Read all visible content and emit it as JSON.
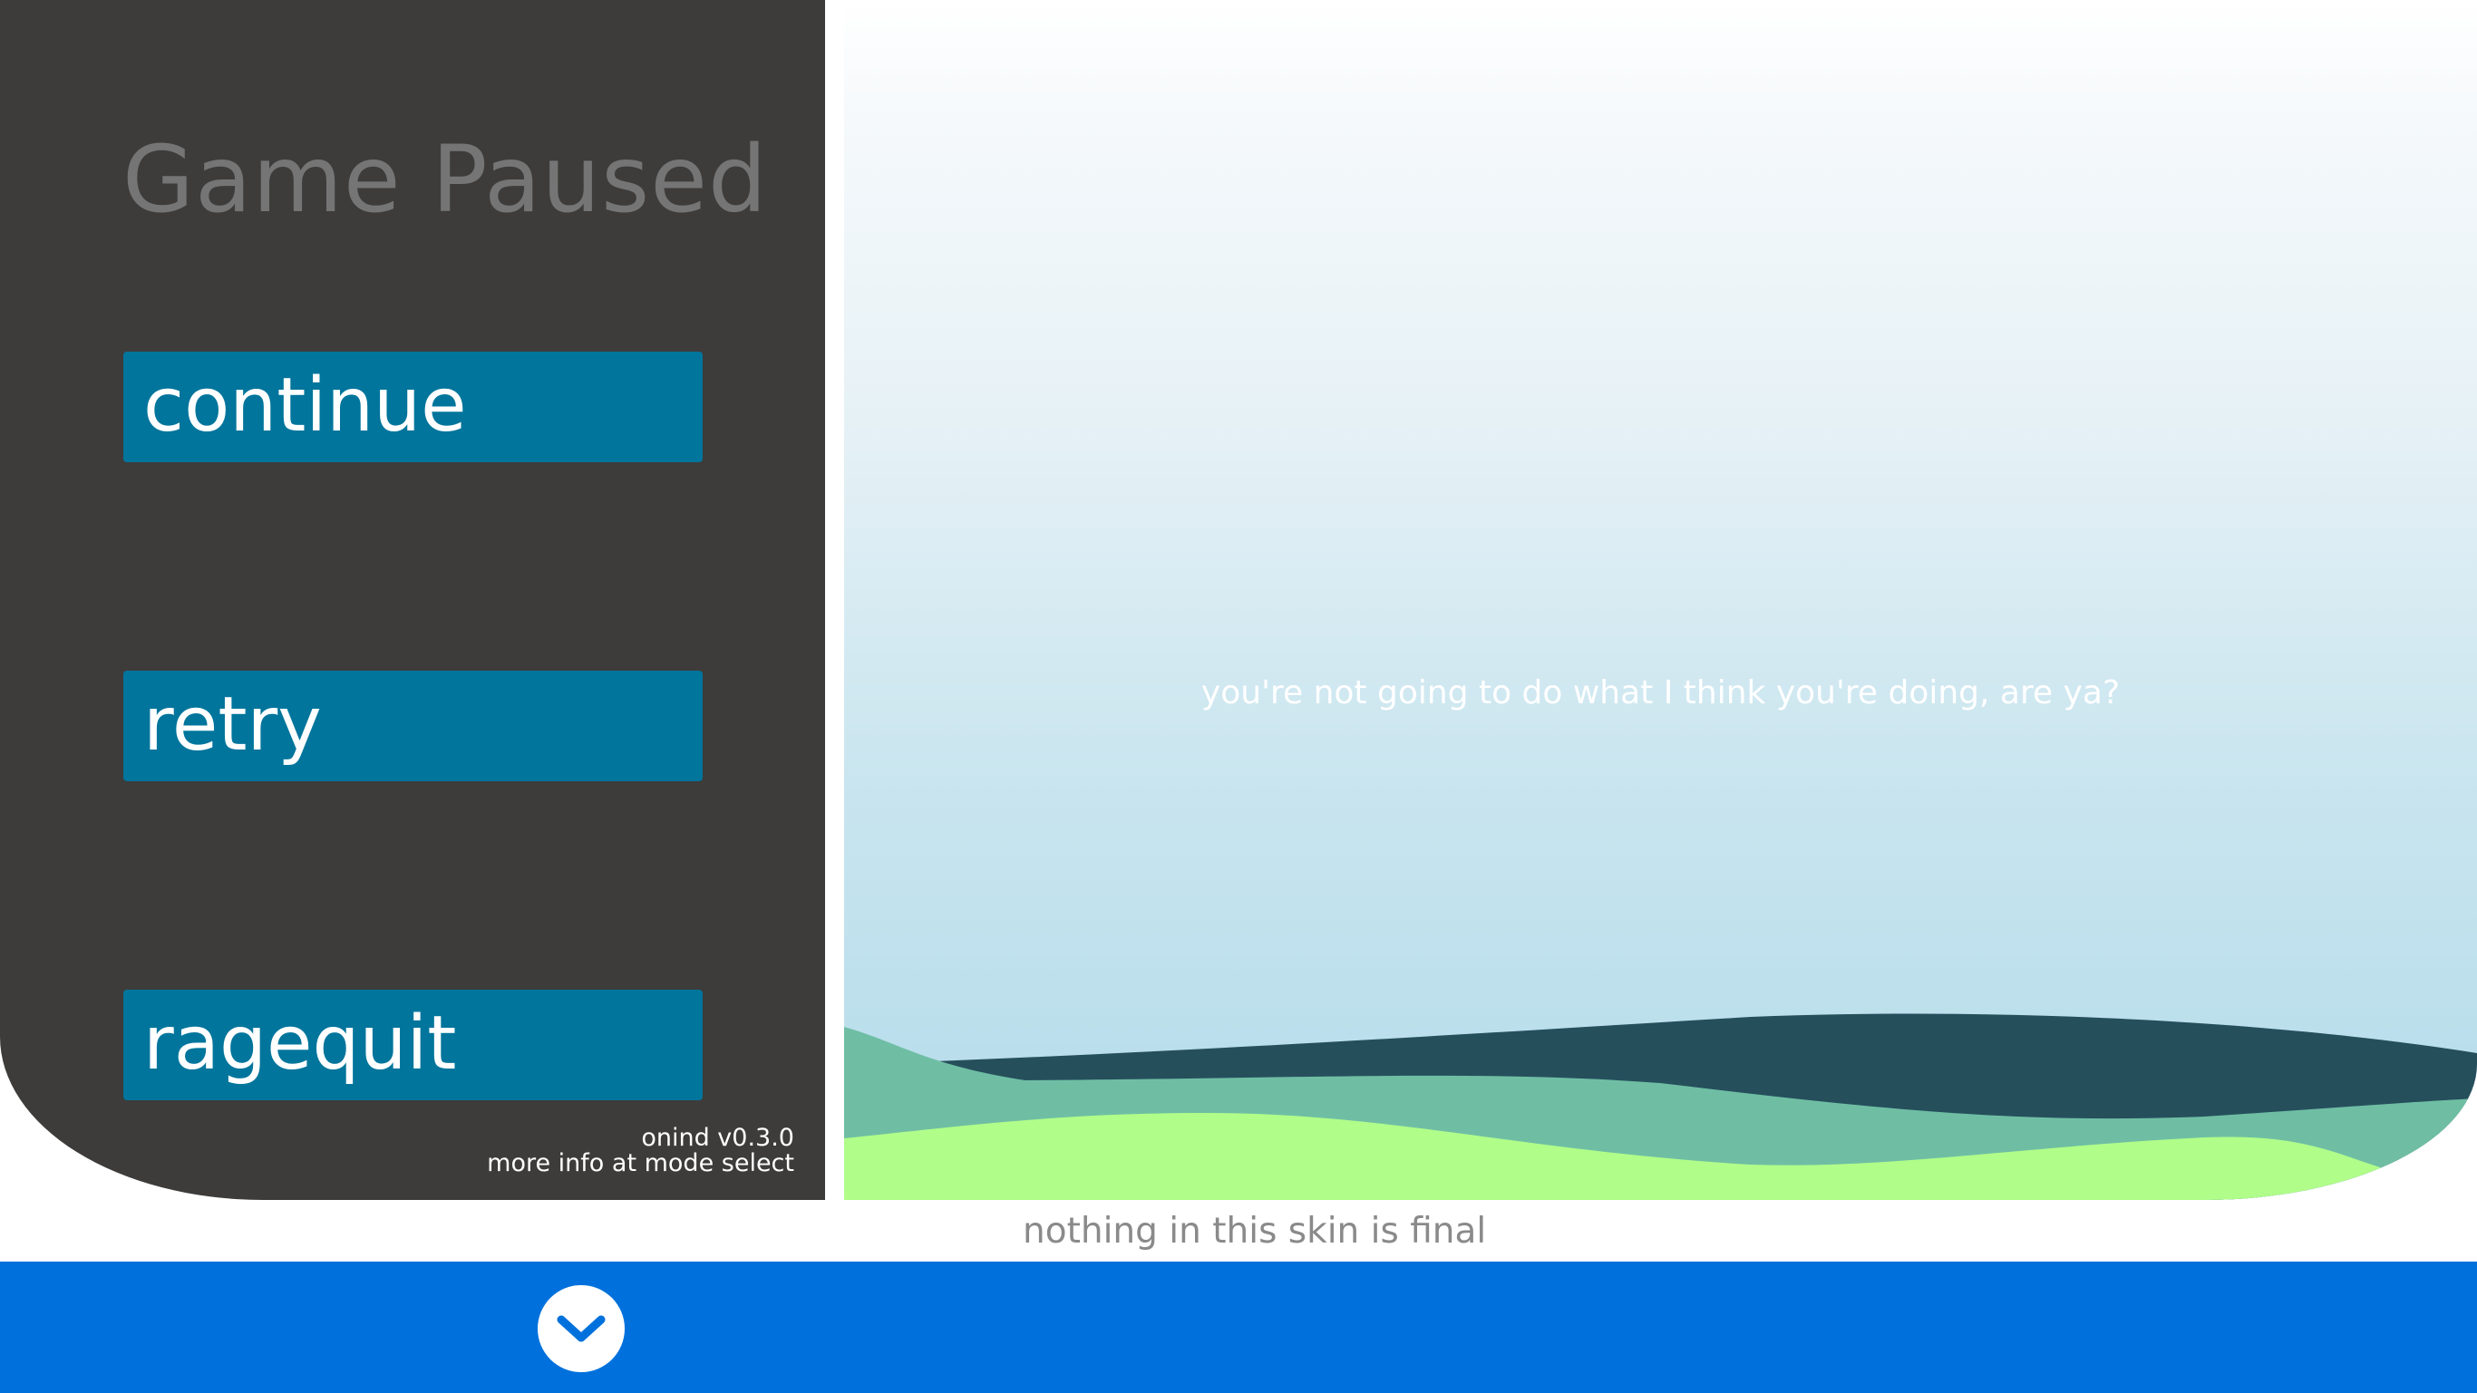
{
  "pause_menu": {
    "title": "Game Paused",
    "buttons": [
      {
        "label": "continue"
      },
      {
        "label": "retry"
      },
      {
        "label": "ragequit"
      }
    ],
    "version": "onind v0.3.0",
    "info": "more info at mode select"
  },
  "game_view": {
    "message": "you're not going to do what I think you're doing, are ya?"
  },
  "footer_note": "nothing in this skin is final",
  "bottom_bar": {
    "icon": "chevron-down-icon"
  },
  "colors": {
    "panel": "#3d3c3b",
    "button": "#01759c",
    "bar": "#0071dc",
    "hill_dark": "#264f5c",
    "hill_mid": "#6fbea4",
    "hill_light": "#b0fd8a"
  }
}
